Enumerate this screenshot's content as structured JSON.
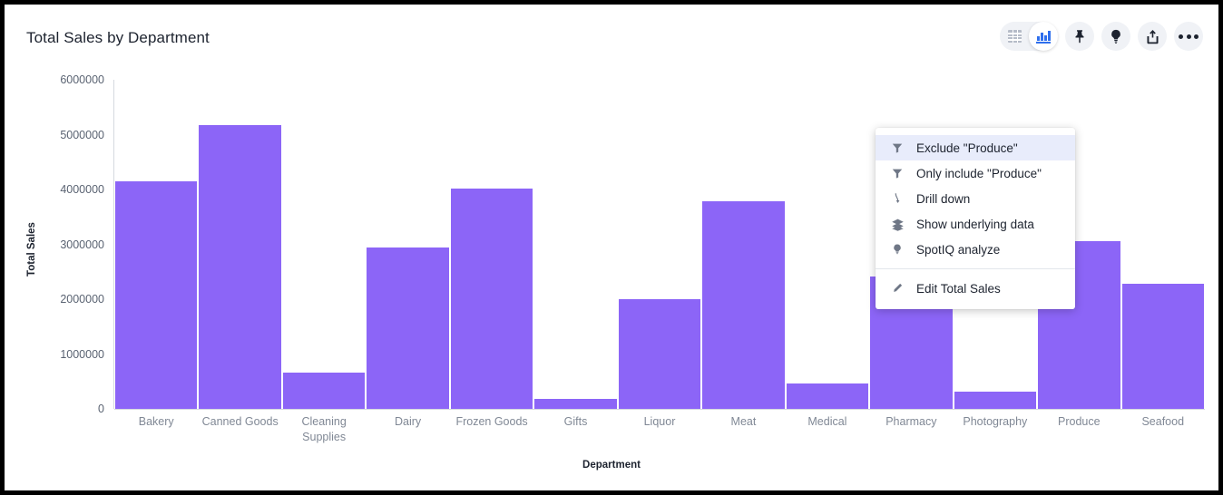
{
  "header": {
    "title": "Total Sales by Department"
  },
  "toolbar": {
    "items": [
      {
        "name": "table-view-icon",
        "label": "Table view"
      },
      {
        "name": "chart-view-icon",
        "label": "Chart view"
      },
      {
        "name": "pin-icon",
        "label": "Pin"
      },
      {
        "name": "lightbulb-icon",
        "label": "SpotIQ"
      },
      {
        "name": "share-icon",
        "label": "Share"
      },
      {
        "name": "more-icon",
        "label": "More"
      }
    ],
    "active_view": "chart-view-icon"
  },
  "context_menu": {
    "items": [
      {
        "label": "Exclude \"Produce\"",
        "icon": "filter-icon",
        "highlighted": true
      },
      {
        "label": "Only include \"Produce\"",
        "icon": "filter-icon",
        "highlighted": false
      },
      {
        "label": "Drill down",
        "icon": "drill-down-icon",
        "highlighted": false
      },
      {
        "label": "Show underlying data",
        "icon": "layers-icon",
        "highlighted": false
      },
      {
        "label": "SpotIQ analyze",
        "icon": "lightbulb-icon",
        "highlighted": false
      }
    ],
    "footer_items": [
      {
        "label": "Edit Total Sales",
        "icon": "pencil-icon",
        "highlighted": false
      }
    ]
  },
  "colors": {
    "bar": "#8c65f7",
    "accent": "#2f6fed",
    "menu_highlight": "#e8ecfb"
  },
  "chart_data": {
    "type": "bar",
    "title": "Total Sales by Department",
    "xlabel": "Department",
    "ylabel": "Total Sales",
    "ylim": [
      0,
      6000000
    ],
    "yticks": [
      0,
      1000000,
      2000000,
      3000000,
      4000000,
      5000000,
      6000000
    ],
    "ytick_labels": [
      "0",
      "1000000",
      "2000000",
      "3000000",
      "4000000",
      "5000000",
      "6000000"
    ],
    "grid": false,
    "legend": "none",
    "categories": [
      "Bakery",
      "Canned Goods",
      "Cleaning Supplies",
      "Dairy",
      "Frozen Goods",
      "Gifts",
      "Liquor",
      "Meat",
      "Medical",
      "Pharmacy",
      "Photography",
      "Produce",
      "Seafood"
    ],
    "values": [
      4150000,
      5170000,
      660000,
      2940000,
      4010000,
      180000,
      2000000,
      3790000,
      460000,
      2410000,
      320000,
      3060000,
      2280000
    ]
  }
}
